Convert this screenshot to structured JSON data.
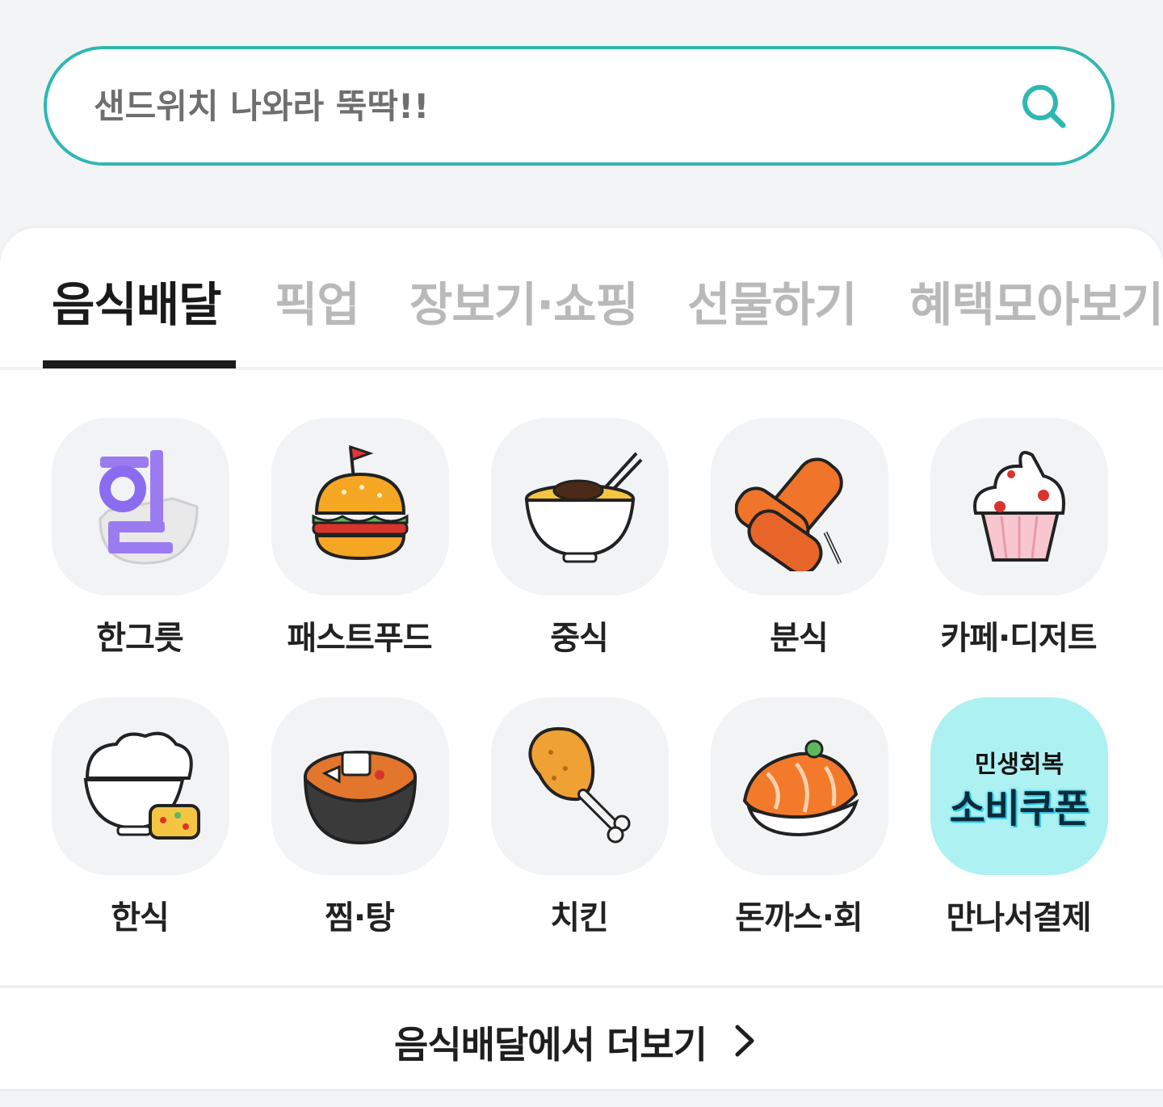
{
  "search": {
    "placeholder": "샌드위치 나와라 뚝딱!!",
    "icon": "search-icon",
    "accent_color": "#2fb7b2"
  },
  "tabs": [
    {
      "label": "음식배달",
      "active": true
    },
    {
      "label": "픽업",
      "active": false
    },
    {
      "label": "장보기·쇼핑",
      "active": false
    },
    {
      "label": "선물하기",
      "active": false
    },
    {
      "label": "혜택모아보기",
      "active": false
    }
  ],
  "categories": [
    {
      "label": "한그릇",
      "icon": "hangeureut-icon"
    },
    {
      "label": "패스트푸드",
      "icon": "burger-icon"
    },
    {
      "label": "중식",
      "icon": "noodle-bowl-icon"
    },
    {
      "label": "분식",
      "icon": "fish-cake-icon"
    },
    {
      "label": "카페·디저트",
      "icon": "cupcake-icon"
    },
    {
      "label": "한식",
      "icon": "rice-bowl-icon"
    },
    {
      "label": "찜·탕",
      "icon": "stew-pot-icon"
    },
    {
      "label": "치킨",
      "icon": "chicken-leg-icon"
    },
    {
      "label": "돈까스·회",
      "icon": "sushi-icon"
    },
    {
      "label": "만나서결제",
      "icon": "coupon-banner",
      "banner_line1": "민생회복",
      "banner_line2": "소비쿠폰"
    }
  ],
  "more": {
    "label": "음식배달에서 더보기",
    "icon": "chevron-right-icon"
  }
}
